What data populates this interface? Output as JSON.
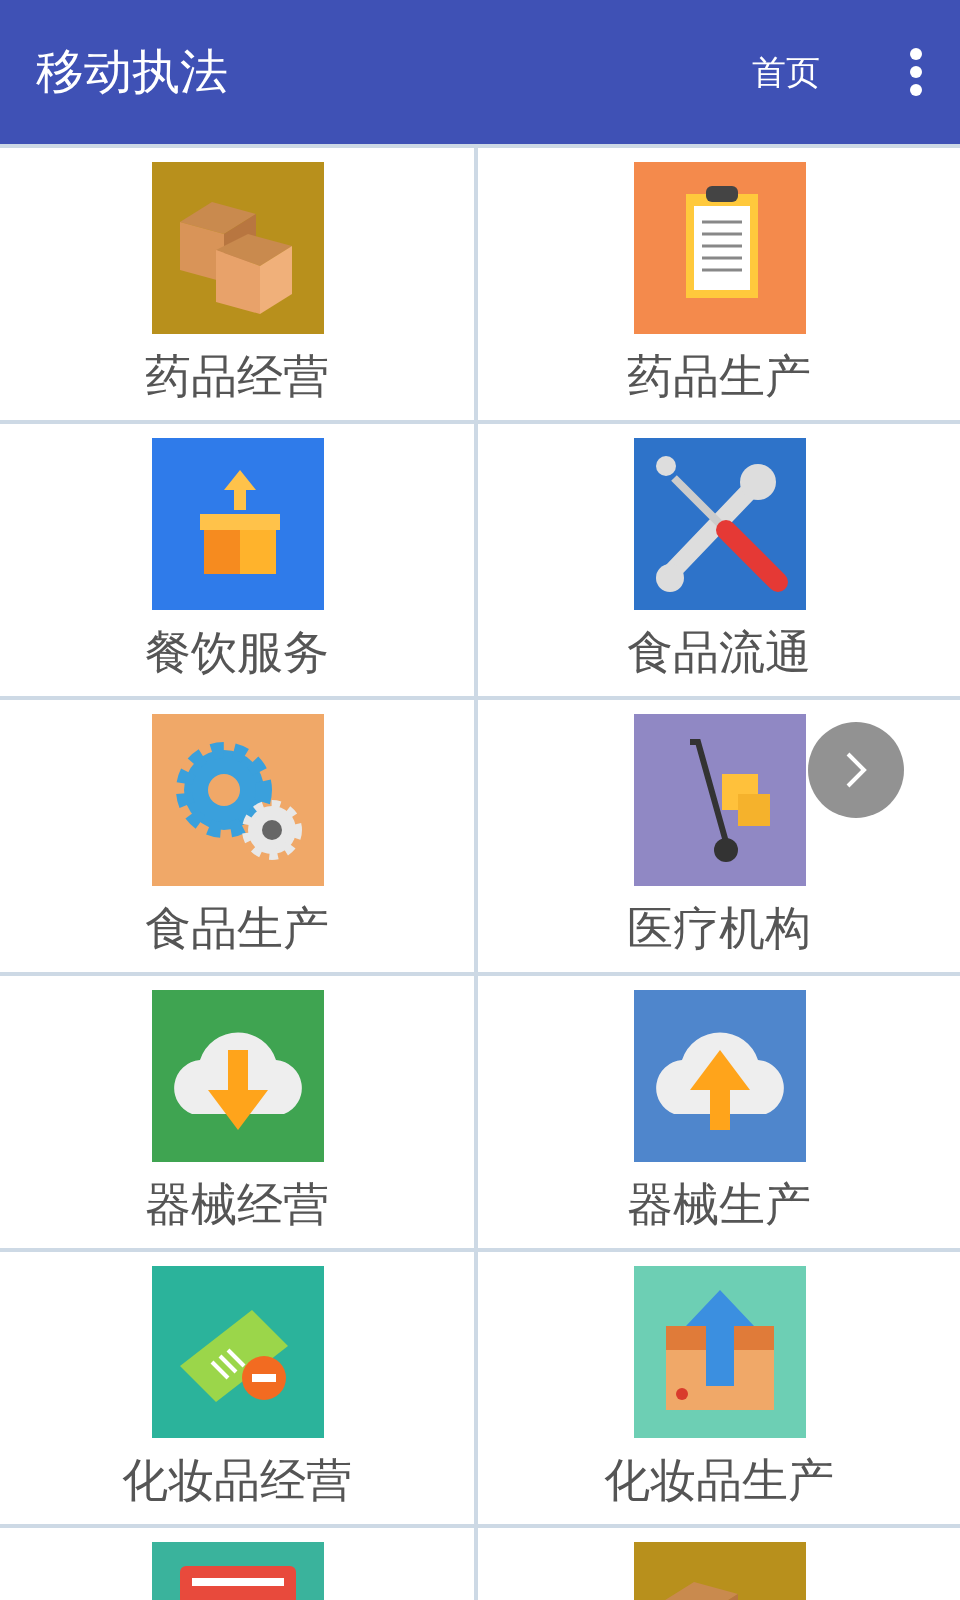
{
  "app_bar": {
    "title": "移动执法",
    "home_link": "首页"
  },
  "items": [
    {
      "label": "药品经营",
      "kind": "boxes",
      "color": "#b8901c"
    },
    {
      "label": "药品生产",
      "kind": "clipboard",
      "color": "#f48a4c"
    },
    {
      "label": "餐饮服务",
      "kind": "box-up",
      "color": "#2f7bea"
    },
    {
      "label": "食品流通",
      "kind": "tools",
      "color": "#2e73c9"
    },
    {
      "label": "食品生产",
      "kind": "gears",
      "color": "#f0a868"
    },
    {
      "label": "医疗机构",
      "kind": "trolley",
      "color": "#9088c4"
    },
    {
      "label": "器械经营",
      "kind": "cloud-down",
      "color": "#3fa451"
    },
    {
      "label": "器械生产",
      "kind": "cloud-up",
      "color": "#4f86cc"
    },
    {
      "label": "化妆品经营",
      "kind": "ticket",
      "color": "#2bb39b"
    },
    {
      "label": "化妆品生产",
      "kind": "box-arrow",
      "color": "#6dcfb4"
    },
    {
      "kind": "card",
      "color": "#3ab39c"
    },
    {
      "kind": "boxes",
      "color": "#b8901c"
    }
  ]
}
